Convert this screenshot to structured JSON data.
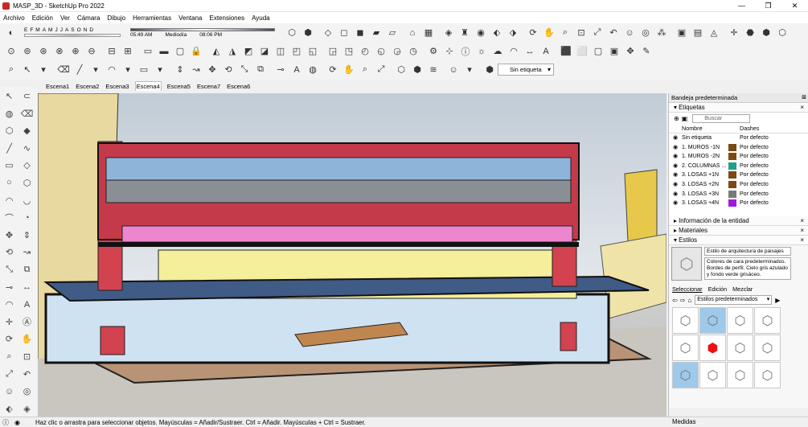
{
  "window": {
    "title": "MASP_3D - SketchUp Pro 2022",
    "min": "—",
    "max": "❐",
    "close": "✕"
  },
  "menu": [
    "Archivo",
    "Edición",
    "Ver",
    "Cámara",
    "Dibujo",
    "Herramientas",
    "Ventana",
    "Extensiones",
    "Ayuda"
  ],
  "shadows": {
    "months": "EFMAMJJASOND",
    "time_start": "05:49 AM",
    "time_mid": "Mediodía",
    "time_end": "08:06 PM"
  },
  "tag_selector": {
    "value": "Sin etiqueta"
  },
  "scenes": [
    "Escena1",
    "Escena2",
    "Escena3",
    "Escena4",
    "Escena5",
    "Escena7",
    "Escena6"
  ],
  "active_scene": "Escena4",
  "tray": {
    "title": "Bandeja predeterminada",
    "tags_section": "Etiquetas",
    "search_placeholder": "Buscar",
    "col_name": "Nombre",
    "col_dashes": "Dashes",
    "tags": [
      {
        "name": "Sin etiqueta",
        "dashes": "Por defecto",
        "color": "#ffffff"
      },
      {
        "name": "1. MUROS -1N",
        "dashes": "Por defecto",
        "color": "#7a4a12"
      },
      {
        "name": "1. MUROS -2N",
        "dashes": "Por defecto",
        "color": "#7a4a12"
      },
      {
        "name": "2. COLUMNAS ...",
        "dashes": "Por defecto",
        "color": "#1ea08a"
      },
      {
        "name": "3. LOSAS +1N",
        "dashes": "Por defecto",
        "color": "#7a4a12"
      },
      {
        "name": "3. LOSAS +2N",
        "dashes": "Por defecto",
        "color": "#7a4a12"
      },
      {
        "name": "3. LOSAS +3N",
        "dashes": "Por defecto",
        "color": "#7a7a7a"
      },
      {
        "name": "3. LOSAS +4N",
        "dashes": "Por defecto",
        "color": "#a018e0"
      }
    ],
    "entity_info": "Información de la entidad",
    "materials": "Materiales",
    "styles": "Estilos",
    "style_name": "Estilo de arquitectura de paisajes",
    "style_desc": "Colores de cara predeterminados. Bordes de perfil. Cielo gris azulado y fondo verde grisáceo.",
    "style_tabs": [
      "Seleccionar",
      "Edición",
      "Mezclar"
    ],
    "style_collection": "Estilos predeterminados"
  },
  "status": {
    "message": "Haz clic o arrastra para seleccionar objetos. Mayúsculas = Añadir/Sustraer. Ctrl = Añadir. Mayúsculas + Ctrl = Sustraer.",
    "measures": "Medidas"
  }
}
